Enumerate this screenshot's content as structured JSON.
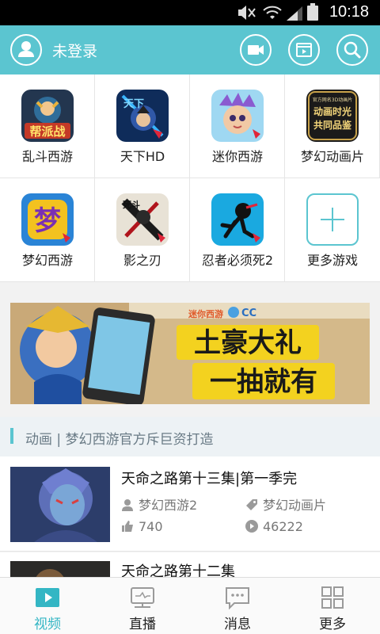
{
  "status_bar": {
    "time": "10:18"
  },
  "header": {
    "login_label": "未登录"
  },
  "games": [
    {
      "name": "乱斗西游",
      "art": "帮派战"
    },
    {
      "name": "天下HD",
      "art": "天下"
    },
    {
      "name": "迷你西游",
      "art": ""
    },
    {
      "name": "梦幻动画片",
      "art": "动画时光共同品鉴",
      "art_small": "官方网名3D动画片"
    },
    {
      "name": "梦幻西游",
      "art": "梦"
    },
    {
      "name": "影之刃",
      "art": "死斗"
    },
    {
      "name": "忍者必须死2",
      "art": ""
    },
    {
      "name": "更多游戏",
      "art": ""
    }
  ],
  "banner": {
    "line1": "土豪大礼",
    "line2": "一抽就有",
    "tag": "迷你西游",
    "cc": "CC"
  },
  "section": {
    "title": "动画 | 梦幻西游官方斥巨资打造"
  },
  "videos": [
    {
      "title": "天命之路第十三集|第一季完",
      "author": "梦幻西游2",
      "category": "梦幻动画片",
      "likes": "740",
      "plays": "46222"
    },
    {
      "title": "天命之路第十二集"
    }
  ],
  "tabs": [
    {
      "label": "视频",
      "active": true
    },
    {
      "label": "直播"
    },
    {
      "label": "消息"
    },
    {
      "label": "更多"
    }
  ],
  "colors": {
    "accent": "#5bc5d0",
    "tab_active": "#34b6c4"
  }
}
